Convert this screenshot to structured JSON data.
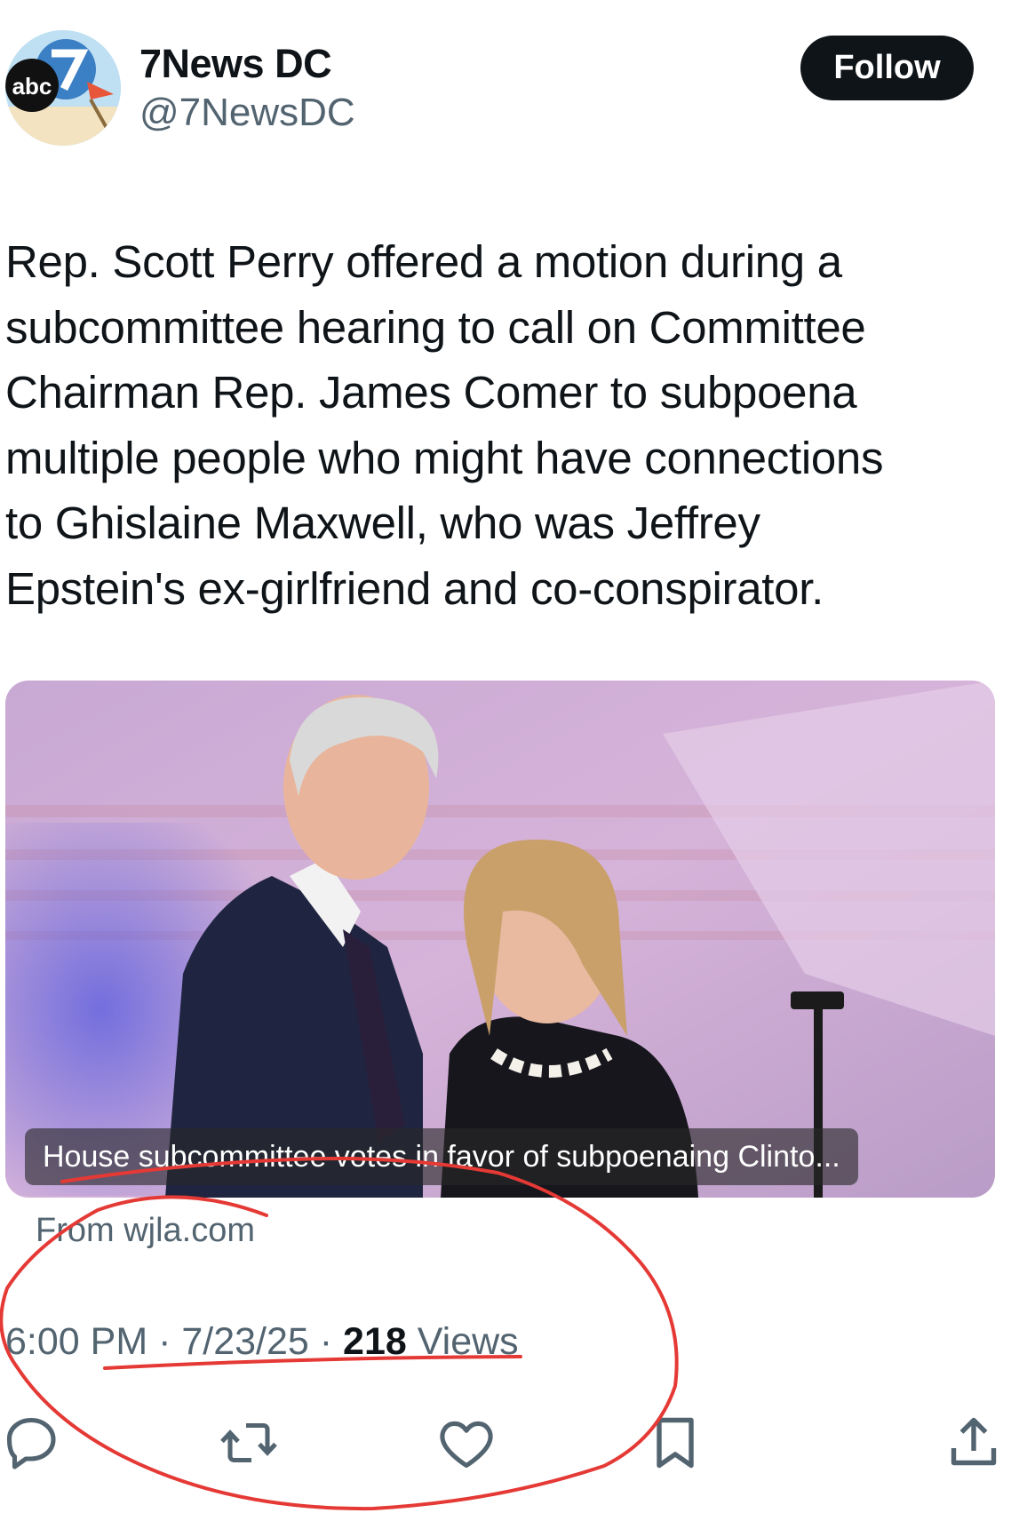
{
  "account": {
    "display_name": "7News DC",
    "handle": "@7NewsDC",
    "avatar_logo_text": "abc"
  },
  "header": {
    "follow_label": "Follow"
  },
  "tweet": {
    "text": "Rep. Scott Perry offered a motion during a\nsubcommittee hearing to call on Committee\nChairman Rep. James Comer to subpoena\nmultiple people who might have connections\nto Ghislaine Maxwell, who was Jeffrey\nEpstein's ex-girlfriend and co-conspirator.",
    "card": {
      "caption": "House subcommittee votes in favor of subpoenaing Clinto...",
      "source": "From wjla.com"
    },
    "meta": {
      "time": "6:00 PM",
      "separator": " · ",
      "date": "7/23/25",
      "views_count": "218",
      "views_label": " Views"
    }
  },
  "actions": [
    {
      "icon": "reply-icon"
    },
    {
      "icon": "repost-icon"
    },
    {
      "icon": "like-icon"
    },
    {
      "icon": "bookmark-icon"
    },
    {
      "icon": "share-icon"
    }
  ],
  "colors": {
    "text_primary": "#0f1419",
    "text_secondary": "#536471",
    "follow_bg": "#0f1419",
    "annotation": "#e53935"
  }
}
